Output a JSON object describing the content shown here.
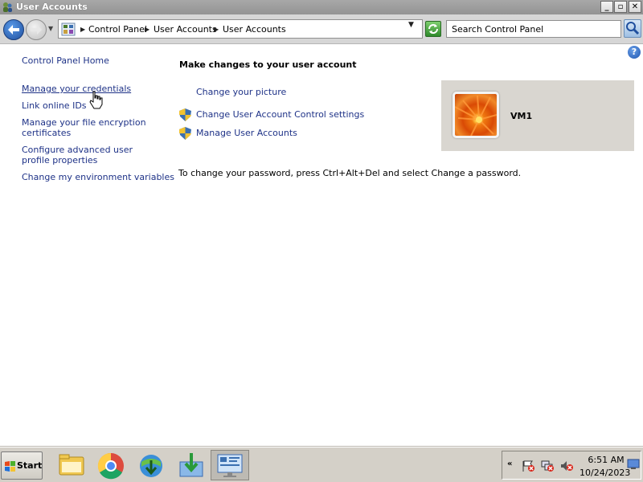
{
  "window": {
    "title": "User Accounts",
    "controls": {
      "minimize": "_",
      "maximize": "▫",
      "close": "✕"
    }
  },
  "addressbar": {
    "breadcrumbs": [
      "Control Panel",
      "User Accounts",
      "User Accounts"
    ],
    "search_placeholder": "Search Control Panel"
  },
  "left_pane": {
    "home": "Control Panel Home",
    "links": [
      "Manage your credentials",
      "Link online IDs",
      "Manage your file encryption certificates",
      "Configure advanced user profile properties",
      "Change my environment variables"
    ]
  },
  "main": {
    "heading": "Make changes to your user account",
    "tasks": [
      "Change your picture",
      "Change User Account Control settings",
      "Manage User Accounts"
    ],
    "password_note": "To change your password, press Ctrl+Alt+Del and select Change a password.",
    "user_name": "VM1"
  },
  "taskbar": {
    "start_label": "Start",
    "apps": [
      "file-explorer-icon",
      "chrome-icon",
      "internet-download-manager-icon",
      "install-icon",
      "control-panel-icon"
    ],
    "tray_arrow": "«",
    "time": "6:51 AM",
    "date": "10/24/2023"
  },
  "colors": {
    "link": "#1e3287",
    "titlebar": "#9e9e9e",
    "taskbar": "#d4d0c8"
  }
}
